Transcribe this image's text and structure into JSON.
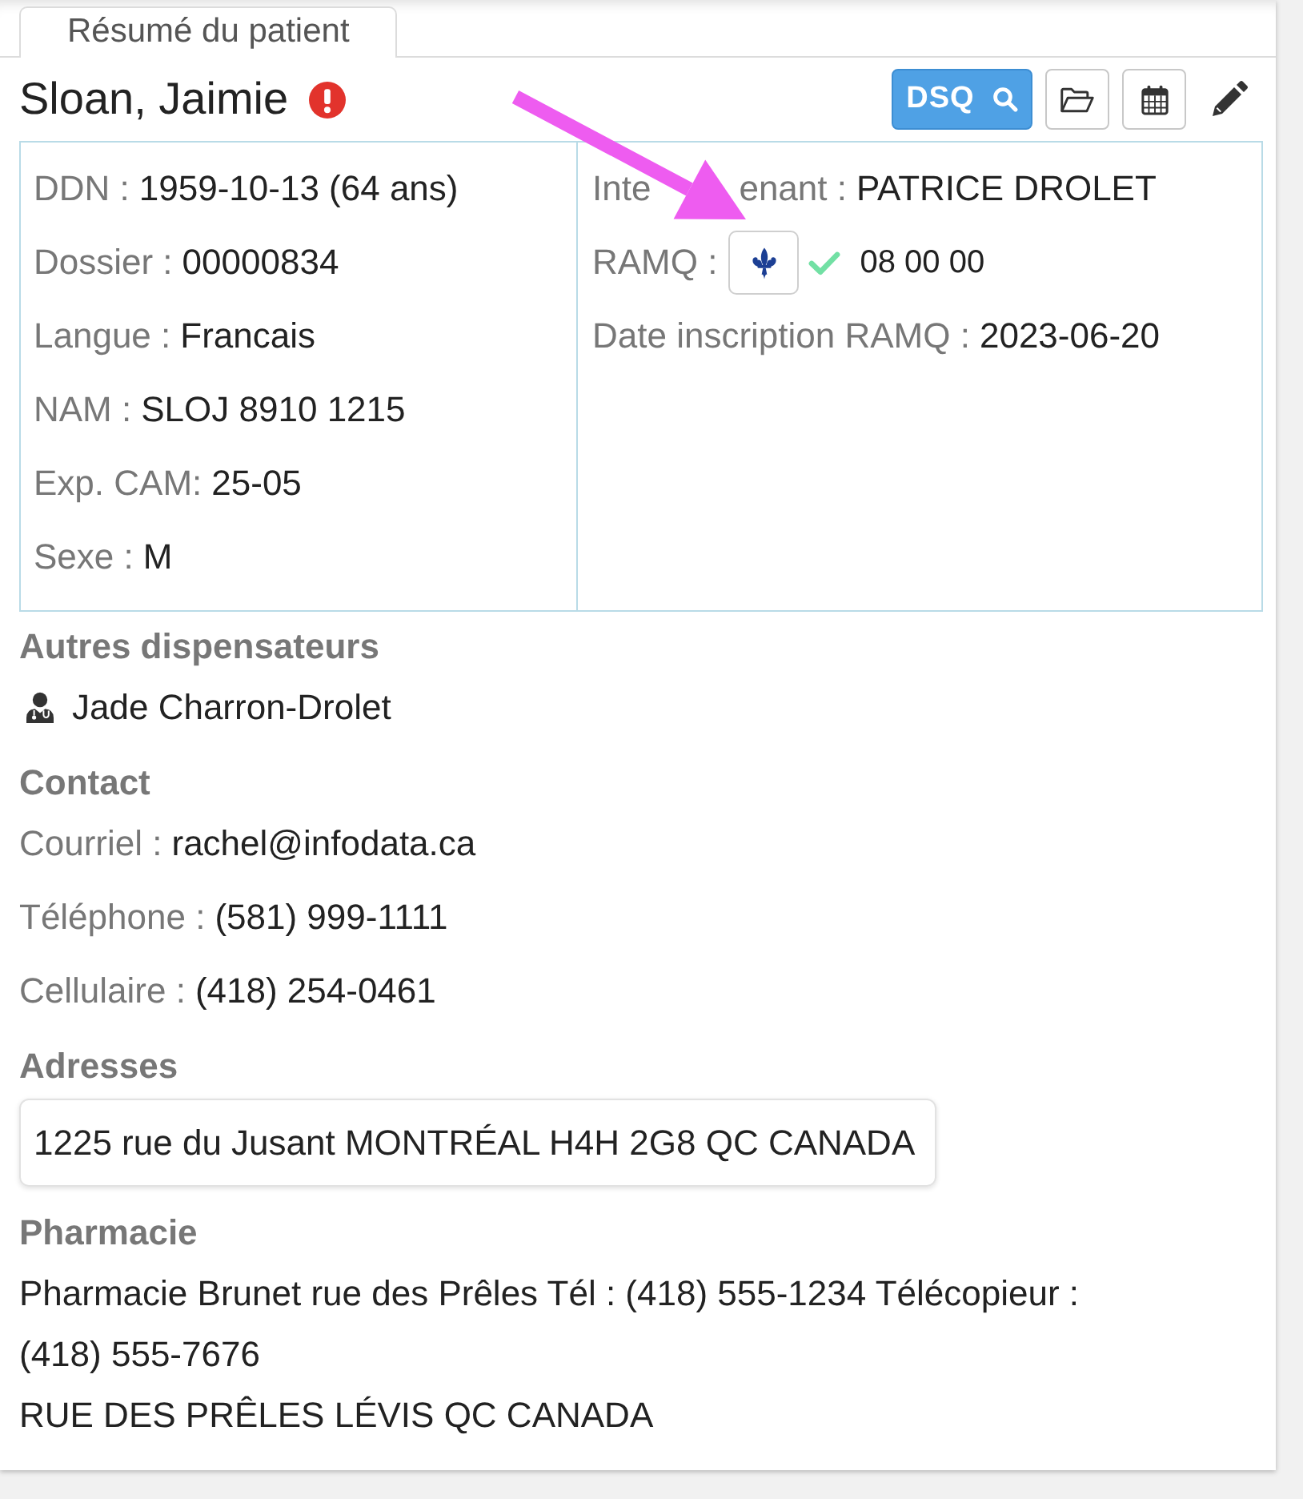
{
  "tabs": [
    {
      "label": "Résumé du patient",
      "selected": true
    }
  ],
  "header": {
    "name": "Sloan, Jaimie",
    "alert": true,
    "buttons": [
      {
        "kind": "dsq",
        "label": "DSQ"
      },
      {
        "kind": "folder"
      },
      {
        "kind": "calendar"
      },
      {
        "kind": "edit"
      }
    ]
  },
  "identity": {
    "left": [
      {
        "label": "DDN :",
        "value": "1959-10-13 (64 ans)"
      },
      {
        "label": "Dossier :",
        "value": "00000834"
      },
      {
        "label": "Langue :",
        "value": "Francais"
      },
      {
        "label": "NAM :",
        "value": "SLOJ 8910 1215"
      },
      {
        "label": "Exp. CAM:",
        "value": "25-05"
      },
      {
        "label": "Sexe :",
        "value": "M"
      }
    ],
    "right": [
      {
        "kind": "text",
        "label_parts": [
          "Inte",
          "enant :"
        ],
        "value": "PATRICE DROLET"
      },
      {
        "kind": "ramq",
        "label": "RAMQ :",
        "verified": true,
        "value": "08 00 00"
      },
      {
        "kind": "text",
        "label": "Date inscription RAMQ :",
        "value": "2023-06-20"
      }
    ]
  },
  "annotation": {
    "kind": "arrow"
  },
  "other_providers": {
    "title": "Autres dispensateurs",
    "items": [
      {
        "name": "Jade Charron-Drolet"
      }
    ]
  },
  "contact": {
    "title": "Contact",
    "fields": [
      {
        "label": "Courriel :",
        "value": "rachel@infodata.ca"
      },
      {
        "label": "Téléphone :",
        "value": "(581) 999-1111"
      },
      {
        "label": "Cellulaire :",
        "value": "(418) 254-0461"
      }
    ]
  },
  "addresses": {
    "title": "Adresses",
    "items": [
      "1225 rue du Jusant MONTRÉAL H4H 2G8 QC CANADA"
    ]
  },
  "pharmacy": {
    "title": "Pharmacie",
    "lines": [
      "Pharmacie Brunet rue des Prêles Tél : (418) 555-1234 Télécopieur : (418) 555-7676",
      "RUE DES PRÊLES LÉVIS QC CANADA"
    ]
  }
}
